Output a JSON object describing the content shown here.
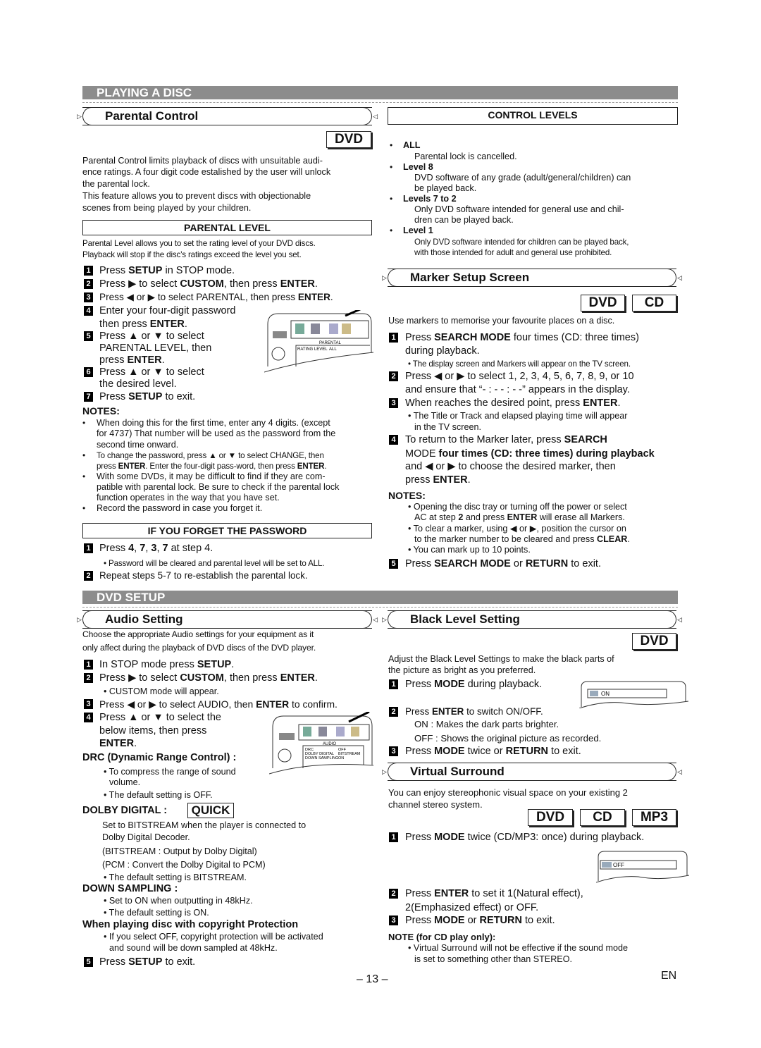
{
  "sections": {
    "playing": "PLAYING A DISC",
    "setup": "DVD SETUP"
  },
  "badges": {
    "dvd": "DVD",
    "cd": "CD",
    "mp3": "MP3",
    "quick": "QUICK"
  },
  "parental": {
    "title": "Parental Control",
    "intro": [
      [
        "Parental Control limits playback of discs with unsuitable audi-"
      ],
      [
        "ence ratings. A four digit code estalished by the user will unlock"
      ],
      [
        "the parental lock."
      ],
      [
        "This feature allows you to prevent discs with objectionable"
      ],
      [
        "scenes from being played by your children."
      ]
    ],
    "level_box": "PARENTAL LEVEL",
    "level_desc": [
      [
        "Parental Level allows you to set the rating level of your DVD discs."
      ],
      [
        "Playback will stop if the disc's ratings exceed the level you set."
      ]
    ],
    "steps": [
      [
        "Press ",
        "SETUP",
        " in STOP mode."
      ],
      [
        "Press ▶ to select ",
        "CUSTOM",
        ", then press ",
        "ENTER",
        "."
      ],
      [
        "Press ◀ or ▶ to select PARENTAL, then press ",
        "ENTER",
        "."
      ],
      [
        "Enter your four-digit password"
      ],
      [
        "then press ",
        "ENTER",
        "."
      ],
      [
        "Press ▲ or ▼ to select"
      ],
      [
        "PARENTAL LEVEL, then"
      ],
      [
        "press ",
        "ENTER",
        "."
      ],
      [
        "Press ▲ or ▼ to select"
      ],
      [
        "the desired level."
      ],
      [
        "Press ",
        "SETUP",
        " to exit."
      ]
    ],
    "step_numbers": [
      "1",
      "2",
      "3",
      "4",
      "5",
      "6",
      "7"
    ],
    "notes_title": "NOTES:",
    "notes": [
      [
        "When doing this for the first time, enter any 4 digits. (except"
      ],
      [
        "for 4737) That number will be used as the password from the"
      ],
      [
        "second time onward."
      ],
      [
        "To change the password, press ▲ or ▼ to select CHANGE, then"
      ],
      [
        "press ",
        "ENTER",
        ". Enter the four-digit pass-word, then press ",
        "ENTER",
        "."
      ],
      [
        "With some DVDs, it may be difficult to find if they are com-"
      ],
      [
        "patible with parental lock. Be sure to check if the parental lock"
      ],
      [
        "function operates in the way that you have set."
      ],
      [
        "Record the password in case you forget it."
      ]
    ],
    "forget_box": "IF YOU FORGET THE PASSWORD",
    "forget": [
      [
        "Press ",
        "4",
        ", ",
        "7",
        ", ",
        "3",
        ", ",
        "7",
        " at step 4."
      ],
      [
        "Password will be cleared and parental level will be set to ALL."
      ],
      [
        "Repeat steps 5-7 to re-establish the parental lock."
      ]
    ],
    "screen": {
      "tab": "PARENTAL",
      "label": "RATING LEVEL",
      "value": "ALL"
    }
  },
  "control": {
    "box": "CONTROL LEVELS",
    "items": [
      {
        "name": "ALL",
        "lines": [
          "Parental lock is cancelled."
        ]
      },
      {
        "name": "Level 8",
        "lines": [
          "DVD software of any grade (adult/general/children) can",
          "be played back."
        ]
      },
      {
        "name": "Levels 7 to 2",
        "lines": [
          "Only DVD software intended for general use and chil-",
          "dren can be played back."
        ]
      },
      {
        "name": "Level 1",
        "lines": [
          "Only DVD software intended for children can be played back,",
          "with those intended for adult and general use prohibited."
        ]
      }
    ]
  },
  "marker": {
    "title": "Marker Setup Screen",
    "intro": [
      [
        "Use markers to memorise your favourite places on a disc."
      ]
    ],
    "lines": [
      [
        "Press ",
        "SEARCH MODE",
        " four times (CD: three times)"
      ],
      [
        "during playback."
      ],
      [
        "• The display screen and Markers will appear on the TV screen."
      ],
      [
        "Press ◀ or ▶ to select 1, 2, 3, 4, 5, 6, 7, 8, 9, or 10"
      ],
      [
        "and ensure that “- : - - : - -” appears in the display."
      ],
      [
        "When reaches the desired point, press ",
        "ENTER",
        "."
      ],
      [
        "• The Title or Track and elapsed playing time will appear"
      ],
      [
        "in the TV screen."
      ],
      [
        "To return to the Marker later, press ",
        "SEARCH"
      ],
      [
        "MODE",
        " four times (CD: three times) during playback"
      ],
      [
        "and ◀ or ▶ to choose the desired marker, then"
      ],
      [
        "press ",
        "ENTER",
        "."
      ],
      [
        "Press ",
        "SEARCH MODE",
        " or ",
        "RETURN",
        " to exit."
      ]
    ],
    "step_numbers": [
      "1",
      "2",
      "3",
      "4",
      "5"
    ],
    "notes_title": "NOTES:",
    "notes": [
      [
        "• Opening the disc tray or turning off the power or select"
      ],
      [
        "AC at step ",
        "2",
        " and press ",
        "ENTER",
        " will erase all Markers."
      ],
      [
        "• To clear a marker, using ◀ or ▶, position the cursor on"
      ],
      [
        "to the marker number to be cleared and press ",
        "CLEAR",
        "."
      ],
      [
        "• You can mark up to 10 points."
      ]
    ]
  },
  "audio": {
    "title": "Audio Setting",
    "intro": [
      [
        "Choose the appropriate Audio settings for your equipment as it"
      ],
      [
        "only affect during the playback of DVD discs of the DVD player."
      ]
    ],
    "lines": [
      [
        "In STOP mode press ",
        "SETUP",
        "."
      ],
      [
        "Press ▶ to select ",
        "CUSTOM",
        ", then press ",
        "ENTER",
        "."
      ],
      [
        "• CUSTOM mode will appear."
      ],
      [
        "Press ◀ or ▶ to select AUDIO, then ",
        "ENTER",
        " to confirm."
      ],
      [
        "Press ▲ or ▼ to select the"
      ],
      [
        "below items, then press"
      ],
      [
        "",
        "ENTER",
        "."
      ],
      [
        "",
        "DRC (Dynamic Range Control) :"
      ],
      [
        "• To compress the range of sound"
      ],
      [
        "volume."
      ],
      [
        "• The default setting is OFF."
      ],
      [
        "",
        "DOLBY DIGITAL :"
      ],
      [
        "Set to BITSTREAM when the player is connected to"
      ],
      [
        "Dolby Digital Decoder."
      ],
      [
        "(BITSTREAM : Output by Dolby Digital)"
      ],
      [
        "(PCM : Convert the Dolby Digital to PCM)"
      ],
      [
        "• The default setting is BITSTREAM."
      ],
      [
        "",
        "DOWN SAMPLING :"
      ],
      [
        "• Set to ON when outputting in 48kHz."
      ],
      [
        "• The default setting is ON."
      ],
      [
        "",
        "When playing disc with copyright Protection"
      ],
      [
        "• If you select OFF, copyright protection will be activated"
      ],
      [
        "and sound will be down sampled at 48kHz."
      ],
      [
        "Press ",
        "SETUP",
        " to exit."
      ]
    ],
    "step_numbers": [
      "1",
      "2",
      "3",
      "4",
      "5"
    ],
    "screen": {
      "tab": "AUDIO",
      "rows": [
        [
          "DRC",
          "OFF"
        ],
        [
          "DOLBY DIGITAL",
          "BITSTREAM"
        ],
        [
          "DOWN SAMPLING",
          "ON"
        ]
      ]
    }
  },
  "black": {
    "title": "Black Level Setting",
    "intro": [
      [
        "Adjust the Black Level Settings to make the black parts of"
      ],
      [
        "the picture as bright as you preferred."
      ]
    ],
    "lines": [
      [
        "Press ",
        "MODE",
        " during playback."
      ],
      [
        "Press ",
        "ENTER",
        " to switch ON/OFF."
      ],
      [
        "ON : Makes the dark parts brighter."
      ],
      [
        "OFF : Shows the original picture as recorded."
      ],
      [
        "Press ",
        "MODE",
        " twice or ",
        "RETURN",
        " to exit."
      ]
    ],
    "step_numbers": [
      "1",
      "2",
      "3"
    ],
    "screen": {
      "value": "ON"
    }
  },
  "surround": {
    "title": "Virtual Surround",
    "intro": [
      [
        "You can enjoy stereophonic visual space on your existing 2"
      ],
      [
        "channel stereo system."
      ]
    ],
    "lines": [
      [
        "Press ",
        "MODE",
        " twice (CD/MP3: once) during playback."
      ],
      [
        "Press ",
        "ENTER",
        " to set it 1(Natural effect),"
      ],
      [
        "2(Emphasized effect) or OFF."
      ],
      [
        "Press ",
        "MODE",
        " or ",
        "RETURN",
        " to exit."
      ],
      [
        "",
        "NOTE (for CD play only):"
      ],
      [
        "• Virtual Surround will not be effective if the sound mode"
      ],
      [
        "is set to something other than STEREO."
      ]
    ],
    "step_numbers": [
      "1",
      "2",
      "3"
    ],
    "screen": {
      "value": "OFF"
    }
  },
  "footer": {
    "page": "– 13 –",
    "lang": "EN"
  }
}
